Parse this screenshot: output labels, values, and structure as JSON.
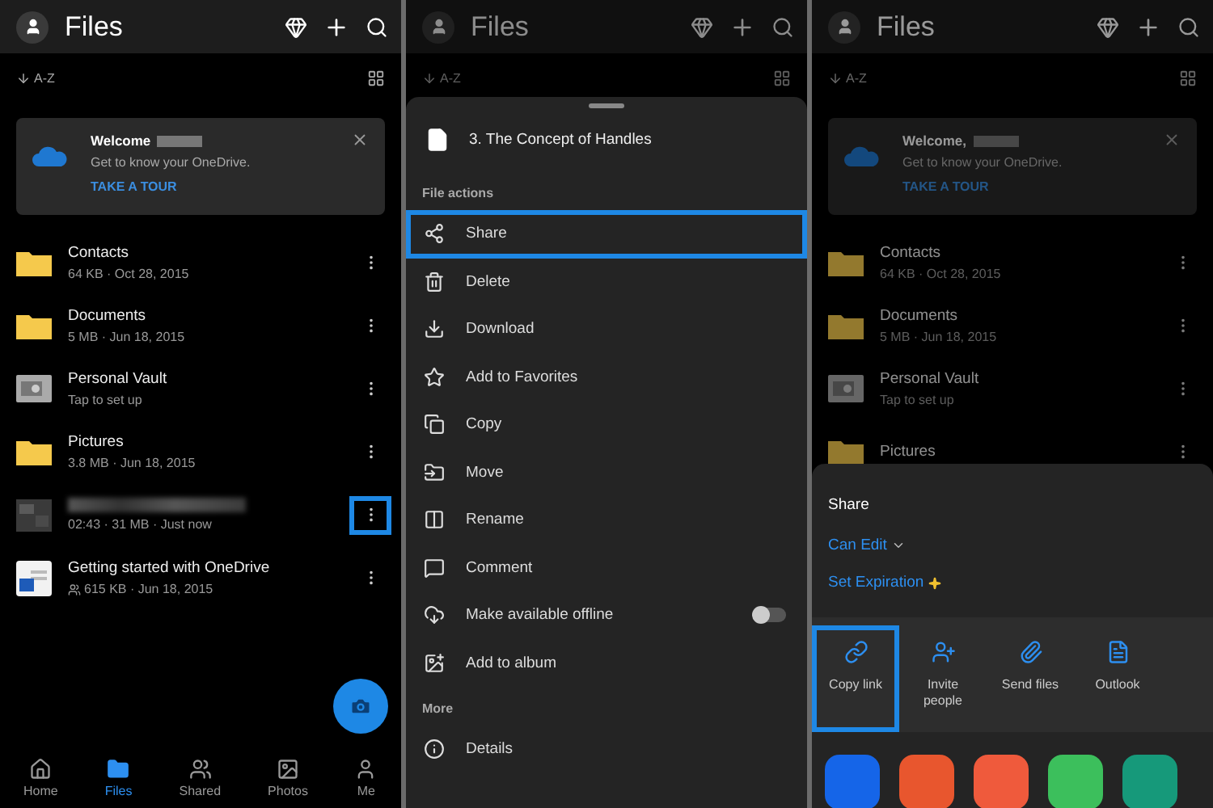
{
  "browse_screen": {
    "title": "Files",
    "sort": "A-Z",
    "welcome": {
      "title": "Welcome",
      "subtitle": "Get to know your OneDrive.",
      "action": "TAKE A TOUR"
    },
    "items": [
      {
        "kind": "folder",
        "title": "Contacts",
        "subtitle": "64 KB · Oct 28, 2015",
        "highlighted": false
      },
      {
        "kind": "folder",
        "title": "Documents",
        "subtitle": "5 MB · Jun 18, 2015",
        "highlighted": false
      },
      {
        "kind": "vault",
        "title": "Personal Vault",
        "subtitle": "Tap to set up",
        "highlighted": false
      },
      {
        "kind": "folder",
        "title": "Pictures",
        "subtitle": "3.8 MB · Jun 18, 2015",
        "highlighted": false
      },
      {
        "kind": "video",
        "subtitle": "02:43 · 31 MB · Just now",
        "highlighted": true
      },
      {
        "kind": "document",
        "title": "Getting started with OneDrive",
        "subtitle": "615 KB · Jun 18, 2015",
        "shared": true,
        "highlighted": false
      }
    ],
    "nav": [
      {
        "label": "Home",
        "kind": "home",
        "selected": false
      },
      {
        "label": "Files",
        "kind": "files",
        "selected": true
      },
      {
        "label": "Shared",
        "kind": "shared",
        "selected": false
      },
      {
        "label": "Photos",
        "kind": "photos",
        "selected": false
      },
      {
        "label": "Me",
        "kind": "me",
        "selected": false
      }
    ]
  },
  "actions_screen": {
    "background": {
      "title": "Files",
      "sort": "A-Z"
    },
    "sheet": {
      "file_name": "3. The Concept of Handles",
      "sections": [
        {
          "heading": "File actions",
          "actions": [
            {
              "kind": "share",
              "label": "Share",
              "highlighted": true
            },
            {
              "kind": "delete",
              "label": "Delete",
              "highlighted": false
            },
            {
              "kind": "download",
              "label": "Download",
              "highlighted": false
            },
            {
              "kind": "favorite",
              "label": "Add to Favorites",
              "highlighted": false
            },
            {
              "kind": "copy",
              "label": "Copy",
              "highlighted": false
            },
            {
              "kind": "move",
              "label": "Move",
              "highlighted": false
            },
            {
              "kind": "rename",
              "label": "Rename",
              "highlighted": false
            },
            {
              "kind": "comment",
              "label": "Comment",
              "highlighted": false
            },
            {
              "kind": "offline",
              "label": "Make available offline",
              "highlighted": false,
              "on": false
            },
            {
              "kind": "album",
              "label": "Add to album",
              "highlighted": false
            }
          ]
        },
        {
          "heading": "More",
          "actions": [
            {
              "kind": "details",
              "label": "Details",
              "highlighted": false
            }
          ]
        }
      ]
    }
  },
  "share_screen": {
    "background": {
      "title": "Files",
      "sort": "A-Z",
      "welcome": {
        "title": "Welcome,",
        "subtitle": "Get to know your OneDrive.",
        "action": "TAKE A TOUR"
      },
      "items": [
        {
          "kind": "folder",
          "title": "Contacts",
          "subtitle": "64 KB · Oct 28, 2015",
          "highlighted": false
        },
        {
          "kind": "folder",
          "title": "Documents",
          "subtitle": "5 MB · Jun 18, 2015",
          "highlighted": false
        },
        {
          "kind": "vault",
          "title": "Personal Vault",
          "subtitle": "Tap to set up",
          "highlighted": false
        },
        {
          "kind": "folder",
          "title": "Pictures",
          "highlighted": false
        }
      ]
    },
    "sheet": {
      "title": "Share",
      "permission": "Can Edit",
      "expiration": "Set Expiration",
      "targets": [
        {
          "kind": "link",
          "label": "Copy link",
          "highlighted": true
        },
        {
          "kind": "invite",
          "label": "Invite people",
          "highlighted": false
        },
        {
          "kind": "attach",
          "label": "Send files",
          "highlighted": false
        },
        {
          "kind": "outlook",
          "label": "Outlook",
          "highlighted": false
        }
      ],
      "apps": [
        {
          "color": "#1565e8"
        },
        {
          "color": "#e8562e"
        },
        {
          "color": "#ef5a3c"
        },
        {
          "color": "#3cbf5c"
        },
        {
          "color": "#16997a"
        }
      ]
    }
  }
}
